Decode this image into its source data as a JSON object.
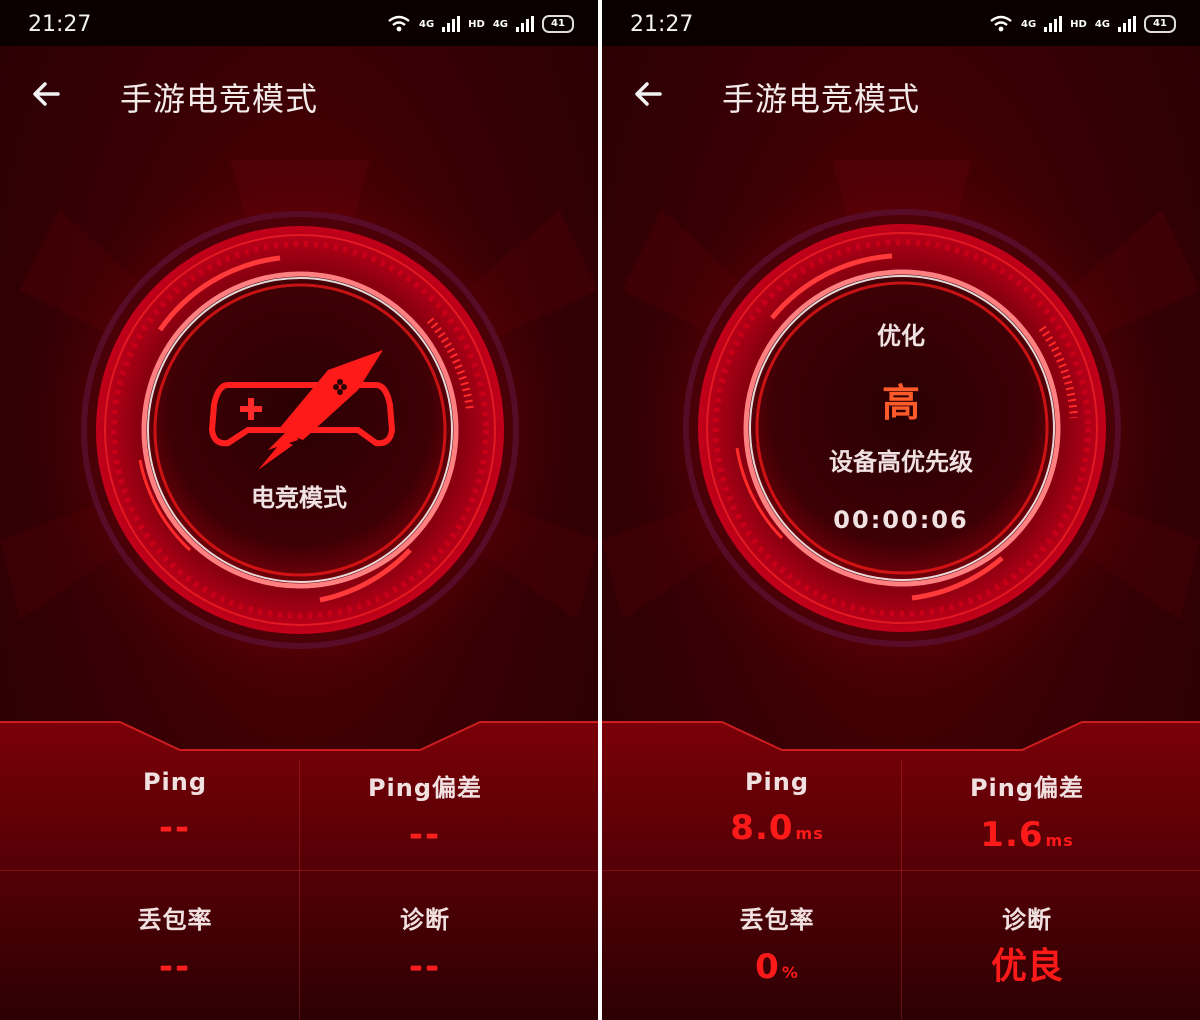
{
  "status": {
    "time": "21:27",
    "net_label_1": "4G",
    "hd_label": "HD",
    "net_label_2": "4G",
    "battery": "41"
  },
  "app": {
    "title": "手游电竞模式"
  },
  "left": {
    "center_label": "电竞模式",
    "metrics": {
      "ping_label": "Ping",
      "ping_value": "--",
      "jitter_label": "Ping偏差",
      "jitter_value": "--",
      "loss_label": "丢包率",
      "loss_value": "--",
      "diag_label": "诊断",
      "diag_value": "--"
    }
  },
  "right": {
    "optimize_label": "优化",
    "priority_value": "高",
    "priority_desc": "设备高优先级",
    "timer": "00:00:06",
    "metrics": {
      "ping_label": "Ping",
      "ping_value": "8.0",
      "ping_unit": "ms",
      "jitter_label": "Ping偏差",
      "jitter_value": "1.6",
      "jitter_unit": "ms",
      "loss_label": "丢包率",
      "loss_value": "0",
      "loss_unit": "%",
      "diag_label": "诊断",
      "diag_value": "优良"
    }
  },
  "colors": {
    "accent": "#ff1a1a",
    "priority": "#ff5a2a",
    "background": "#3a0004"
  }
}
